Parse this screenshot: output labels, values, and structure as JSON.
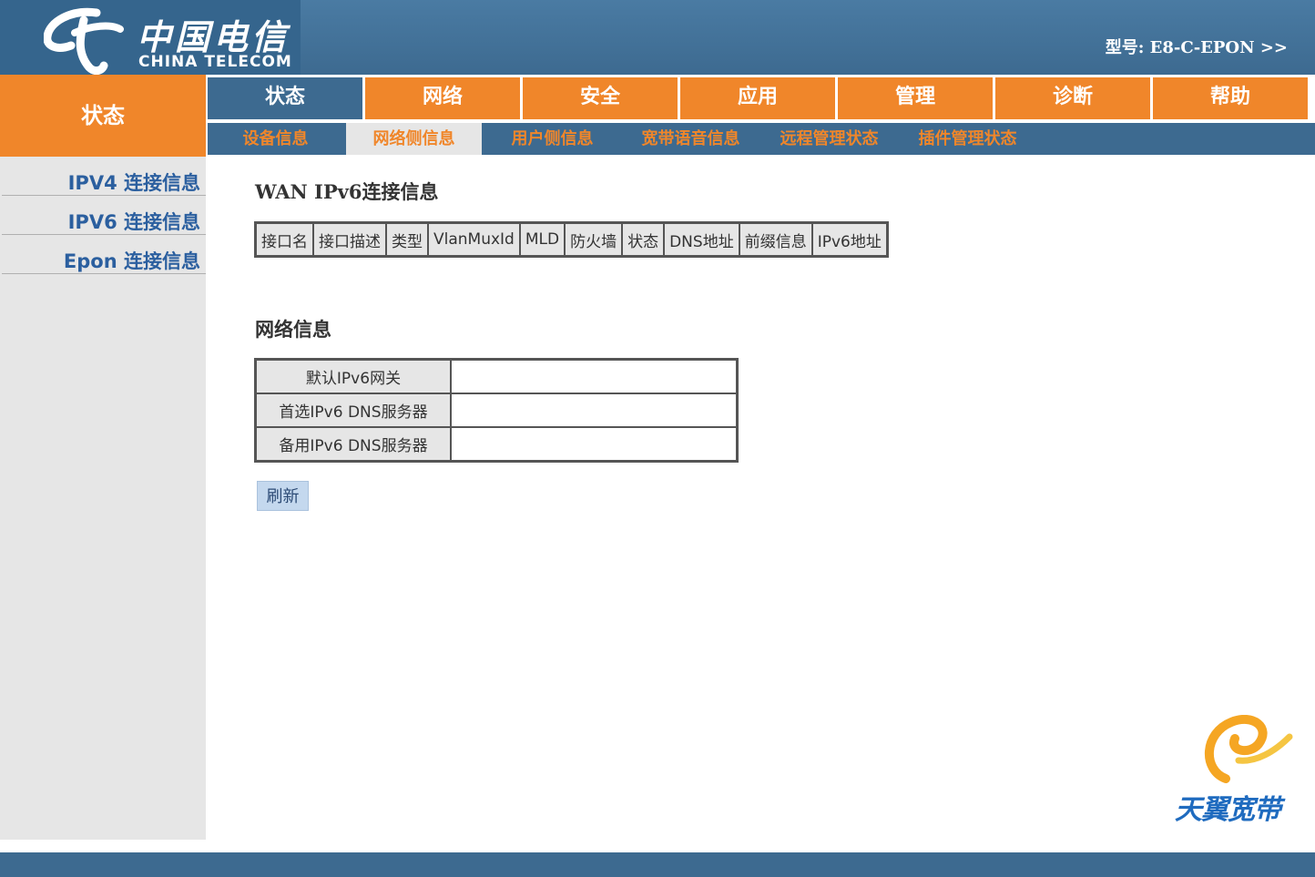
{
  "header": {
    "logo_cn": "中国电信",
    "logo_en": "CHINA TELECOM",
    "model": "型号: E8-C-EPON >>"
  },
  "section_title": "状态",
  "main_nav": [
    "状态",
    "网络",
    "安全",
    "应用",
    "管理",
    "诊断",
    "帮助"
  ],
  "sub_nav": [
    "设备信息",
    "网络侧信息",
    "用户侧信息",
    "宽带语音信息",
    "远程管理状态",
    "插件管理状态",
    ""
  ],
  "sidebar": [
    "IPV4 连接信息",
    "IPV6 连接信息",
    "Epon 连接信息"
  ],
  "wan": {
    "title": "WAN IPv6连接信息",
    "columns": [
      "接口名",
      "接口描述",
      "类型",
      "VlanMuxId",
      "MLD",
      "防火墙",
      "状态",
      "DNS地址",
      "前缀信息",
      "IPv6地址"
    ]
  },
  "network": {
    "title": "网络信息",
    "rows": [
      {
        "label": "默认IPv6网关",
        "value": ""
      },
      {
        "label": "首选IPv6 DNS服务器",
        "value": ""
      },
      {
        "label": "备用IPv6 DNS服务器",
        "value": ""
      }
    ]
  },
  "refresh_label": "刷新",
  "brand_text": "天翼宽带",
  "colors": {
    "orange": "#f0862a",
    "blue": "#3d6a90",
    "sidebar": "#e6e6e6"
  }
}
